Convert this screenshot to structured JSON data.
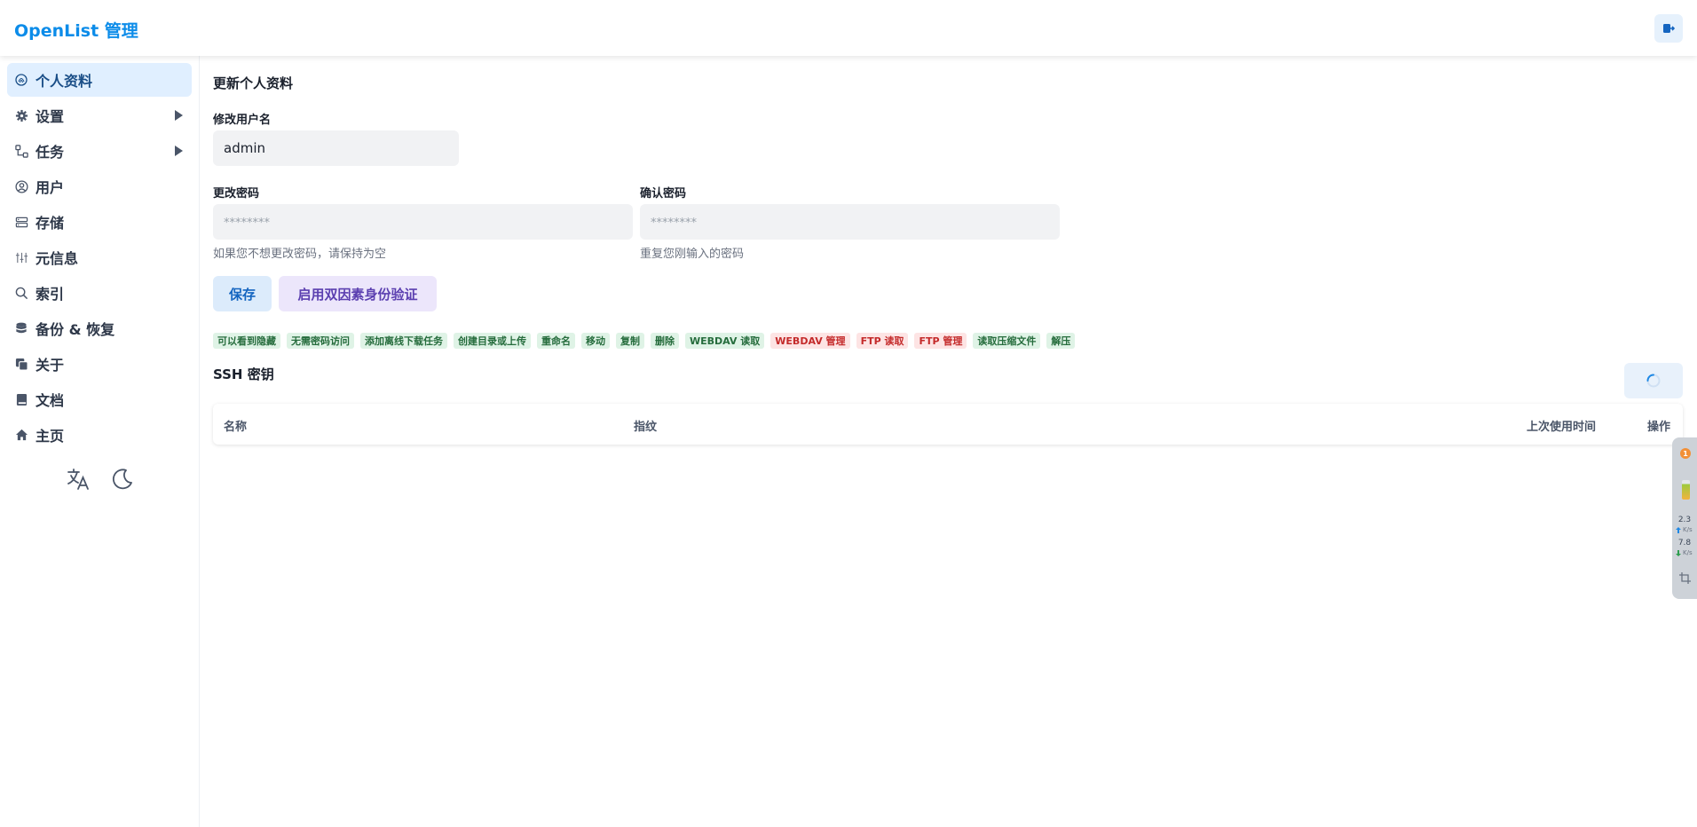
{
  "app": {
    "title": "OpenList 管理"
  },
  "sidebar": {
    "items": [
      {
        "label": "个人资料",
        "icon": "fingerprint-icon",
        "active": true
      },
      {
        "label": "设置",
        "icon": "gear-icon",
        "has_children": true
      },
      {
        "label": "任务",
        "icon": "workflow-icon",
        "has_children": true
      },
      {
        "label": "用户",
        "icon": "user-circle-icon"
      },
      {
        "label": "存储",
        "icon": "database-server-icon"
      },
      {
        "label": "元信息",
        "icon": "metadata-icon"
      },
      {
        "label": "索引",
        "icon": "search-icon"
      },
      {
        "label": "备份 & 恢复",
        "icon": "database-icon"
      },
      {
        "label": "关于",
        "icon": "copy-icon"
      },
      {
        "label": "文档",
        "icon": "book-icon"
      },
      {
        "label": "主页",
        "icon": "home-icon"
      }
    ],
    "tools": {
      "language_icon": "translate-icon",
      "theme_icon": "moon-icon"
    }
  },
  "profile": {
    "title": "更新个人资料",
    "username_label": "修改用户名",
    "username_value": "admin",
    "password_label": "更改密码",
    "password_placeholder": "********",
    "password_help": "如果您不想更改密码，请保持为空",
    "confirm_label": "确认密码",
    "confirm_placeholder": "********",
    "confirm_help": "重复您刚输入的密码",
    "save_label": "保存",
    "twofa_label": "启用双因素身份验证"
  },
  "permissions": [
    {
      "label": "可以看到隐藏",
      "granted": true
    },
    {
      "label": "无需密码访问",
      "granted": true
    },
    {
      "label": "添加离线下载任务",
      "granted": true
    },
    {
      "label": "创建目录或上传",
      "granted": true
    },
    {
      "label": "重命名",
      "granted": true
    },
    {
      "label": "移动",
      "granted": true
    },
    {
      "label": "复制",
      "granted": true
    },
    {
      "label": "删除",
      "granted": true
    },
    {
      "label": "WEBDAV 读取",
      "granted": true
    },
    {
      "label": "WEBDAV 管理",
      "granted": false
    },
    {
      "label": "FTP 读取",
      "granted": false
    },
    {
      "label": "FTP 管理",
      "granted": false
    },
    {
      "label": "读取压缩文件",
      "granted": true
    },
    {
      "label": "解压",
      "granted": true
    }
  ],
  "ssh": {
    "title": "SSH 密钥",
    "columns": {
      "name": "名称",
      "fingerprint": "指纹",
      "last_used": "上次使用时间",
      "actions": "操作"
    }
  },
  "float_widget": {
    "badge": "1",
    "upload_value": "2.3",
    "upload_unit": "K/s",
    "download_value": "7.8",
    "download_unit": "K/s"
  },
  "colors": {
    "accent": "#0c8ce9",
    "granted_bg": "#dff3e6",
    "denied_bg": "#fde4e4"
  }
}
